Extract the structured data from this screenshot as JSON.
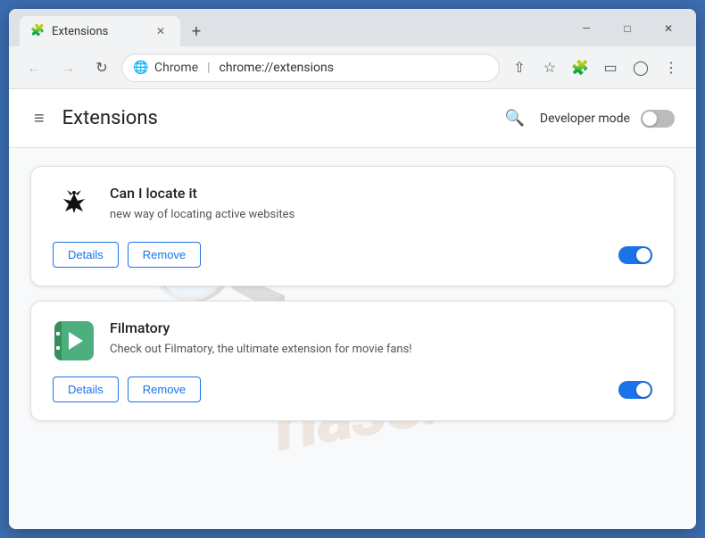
{
  "browser": {
    "tab": {
      "title": "Extensions",
      "favicon": "🧩"
    },
    "new_tab_label": "+",
    "nav": {
      "back_disabled": true,
      "forward_disabled": true,
      "address": {
        "favicon": "🌐",
        "site_name": "Chrome",
        "url": "chrome://extensions"
      }
    },
    "window_controls": {
      "minimize": "—",
      "maximize": "□",
      "close": "✕"
    }
  },
  "page": {
    "title": "Extensions",
    "menu_icon": "≡",
    "search_icon": "🔍",
    "dev_mode_label": "Developer mode",
    "dev_mode_on": false
  },
  "extensions": [
    {
      "id": "can-locate-it",
      "name": "Can I locate it",
      "description": "new way of locating active websites",
      "enabled": true,
      "details_label": "Details",
      "remove_label": "Remove"
    },
    {
      "id": "filmatory",
      "name": "Filmatory",
      "description": "Check out Filmatory, the ultimate extension for movie fans!",
      "enabled": true,
      "details_label": "Details",
      "remove_label": "Remove"
    }
  ],
  "watermark": {
    "text": "riase.com"
  }
}
